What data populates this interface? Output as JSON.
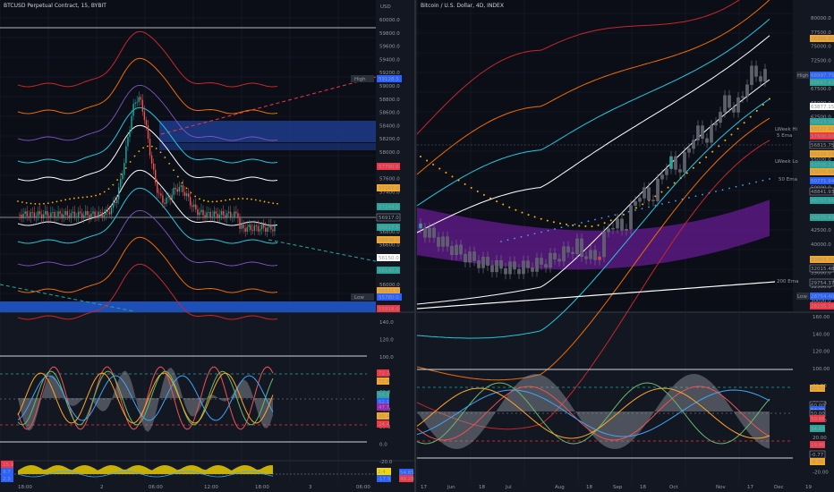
{
  "left_panel": {
    "title": "BTCUSD Perpetual Contract, 15, BYBIT",
    "currency": "USD",
    "price_ticks": [
      "60000.0",
      "59800.0",
      "59600.0",
      "59400.0",
      "59200.0",
      "59000.0",
      "58800.0",
      "58600.0",
      "58400.0",
      "58200.0",
      "58000.0",
      "57800.0",
      "57600.0",
      "57400.0",
      "57200.0",
      "57000.0",
      "56800.0",
      "56600.0",
      "56400.0",
      "56200.0",
      "56000.0",
      "55800.0"
    ],
    "price_tags": [
      {
        "label": "High",
        "value": "59128.5",
        "color": "#2962ff"
      },
      {
        "label": "",
        "value": "57790.0",
        "color": "#f23645"
      },
      {
        "label": "",
        "value": "57167.0",
        "color": "#f5a623"
      },
      {
        "label": "",
        "value": "57144.0",
        "color": "#26a69a"
      },
      {
        "label": "",
        "value": "56917.0",
        "color": "#131722"
      },
      {
        "label": "",
        "value": "56817.5",
        "color": "#26a69a"
      },
      {
        "label": "",
        "value": "56836.0",
        "color": "#f5a623"
      },
      {
        "label": "",
        "value": "56150.0",
        "color": "#ffffff"
      },
      {
        "label": "",
        "value": "56140.0",
        "color": "#26a69a"
      },
      {
        "label": "",
        "value": "55811.0",
        "color": "#f5a623"
      },
      {
        "label": "Low",
        "value": "55780.0",
        "color": "#2962ff"
      },
      {
        "label": "",
        "value": "55918.0",
        "color": "#f23645"
      }
    ],
    "osc_ticks": [
      "140.0",
      "120.0",
      "100.0",
      "80.0",
      "60.0",
      "40.0",
      "20.0",
      "0.0",
      "-20.0"
    ],
    "osc_tags": [
      {
        "value": "72.7",
        "color": "#f23645"
      },
      {
        "value": "71.4",
        "color": "#f5a623"
      },
      {
        "value": "56.9",
        "color": "#26a69a"
      },
      {
        "value": "52.1",
        "color": "#2962ff"
      },
      {
        "value": "47.7",
        "color": "#9c27b0"
      },
      {
        "value": "33.4",
        "color": "#f5a623"
      },
      {
        "value": "24.4",
        "color": "#f23645"
      }
    ],
    "bottom_tags": [
      {
        "value": "2.4",
        "color": "#f5d800"
      },
      {
        "value": "54.85",
        "color": "#2962ff"
      },
      {
        "value": "-17.9",
        "color": "#2962ff"
      },
      {
        "value": "49.28",
        "color": "#f23645"
      }
    ],
    "left_mini_tags": [
      {
        "value": "15.9",
        "color": "#f23645"
      },
      {
        "value": "9.7",
        "color": "#2962ff"
      },
      {
        "value": "2.3",
        "color": "#2962ff"
      }
    ],
    "time_ticks": [
      "18:00",
      "2",
      "06:00",
      "12:00",
      "18:00",
      "3",
      "06:00"
    ]
  },
  "right_panel": {
    "title": "Bitcoin / U.S. Dollar, 4D, INDEX",
    "price_ticks": [
      "80000.0",
      "77500.0",
      "75000.0",
      "72500.0",
      "70000.0",
      "67500.0",
      "65000.0",
      "62500.0",
      "60000.0",
      "57500.0",
      "55000.0",
      "52500.0",
      "50000.0",
      "47500.0",
      "45000.0",
      "42500.0",
      "40000.0",
      "37500.0",
      "35000.0",
      "32500.0",
      "30000.0"
    ],
    "price_tags": [
      {
        "label": "",
        "value": "76366.85",
        "color": "#f5a623"
      },
      {
        "label": "High",
        "value": "68997.75",
        "color": "#2962ff"
      },
      {
        "label": "",
        "value": "65667.42",
        "color": "#26a69a"
      },
      {
        "label": "",
        "value": "63877.15",
        "color": "#ffffff"
      },
      {
        "label": "",
        "value": "59523.36",
        "color": "#26a69a"
      },
      {
        "label": "",
        "value": "58127.40",
        "color": "#f5a623"
      },
      {
        "label": "",
        "value": "57600.00",
        "color": "#f23645"
      },
      {
        "label": "",
        "value": "56815.75",
        "color": "#131722"
      },
      {
        "label": "",
        "value": "56129.19",
        "color": "#f5a623"
      },
      {
        "label": "",
        "value": "53705.23",
        "color": "#26a69a"
      },
      {
        "label": "",
        "value": "53075.68",
        "color": "#f5a623"
      },
      {
        "label": "",
        "value": "50771.94",
        "color": "#2962ff"
      },
      {
        "label": "",
        "value": "48841.93",
        "color": "#131722"
      },
      {
        "label": "",
        "value": "46737.56",
        "color": "#26a69a"
      },
      {
        "label": "",
        "value": "43675.43",
        "color": "#26a69a"
      },
      {
        "label": "",
        "value": "33963.30",
        "color": "#f5a623"
      },
      {
        "label": "",
        "value": "32015.48",
        "color": "#131722"
      },
      {
        "label": "",
        "value": "29754.37",
        "color": "#131722"
      },
      {
        "label": "Low",
        "value": "28754.40",
        "color": "#2962ff"
      },
      {
        "label": "",
        "value": "28235.16",
        "color": "#f23645"
      }
    ],
    "labels": {
      "week_hi": "LWeek Hi",
      "ema5": "5 Ema",
      "week_lo": "LWeek Lo",
      "ema50": "50 Ema",
      "ema200": "200 Ema"
    },
    "osc_ticks": [
      "160.00",
      "140.00",
      "120.00",
      "100.00",
      "80.00",
      "60.00",
      "40.00",
      "20.00",
      "0.00",
      "-20.00"
    ],
    "osc_tags": [
      {
        "value": "80.50",
        "color": "#f5a623"
      },
      {
        "value": "60.00",
        "color": "#131722"
      },
      {
        "value": "54.39",
        "color": "#2962ff"
      },
      {
        "value": "50.00",
        "color": "#131722"
      },
      {
        "value": "50.86",
        "color": "#f23645"
      },
      {
        "value": "34.03",
        "color": "#26a69a"
      },
      {
        "value": "19.86",
        "color": "#f23645"
      },
      {
        "value": "-0.77",
        "color": "#131722"
      },
      {
        "value": "-6.35",
        "color": "#f5a623"
      }
    ],
    "time_ticks": [
      "17",
      "Jun",
      "18",
      "Jul",
      "Aug",
      "18",
      "Sep",
      "18",
      "Oct",
      "Nov",
      "17",
      "Dec",
      "19"
    ]
  }
}
